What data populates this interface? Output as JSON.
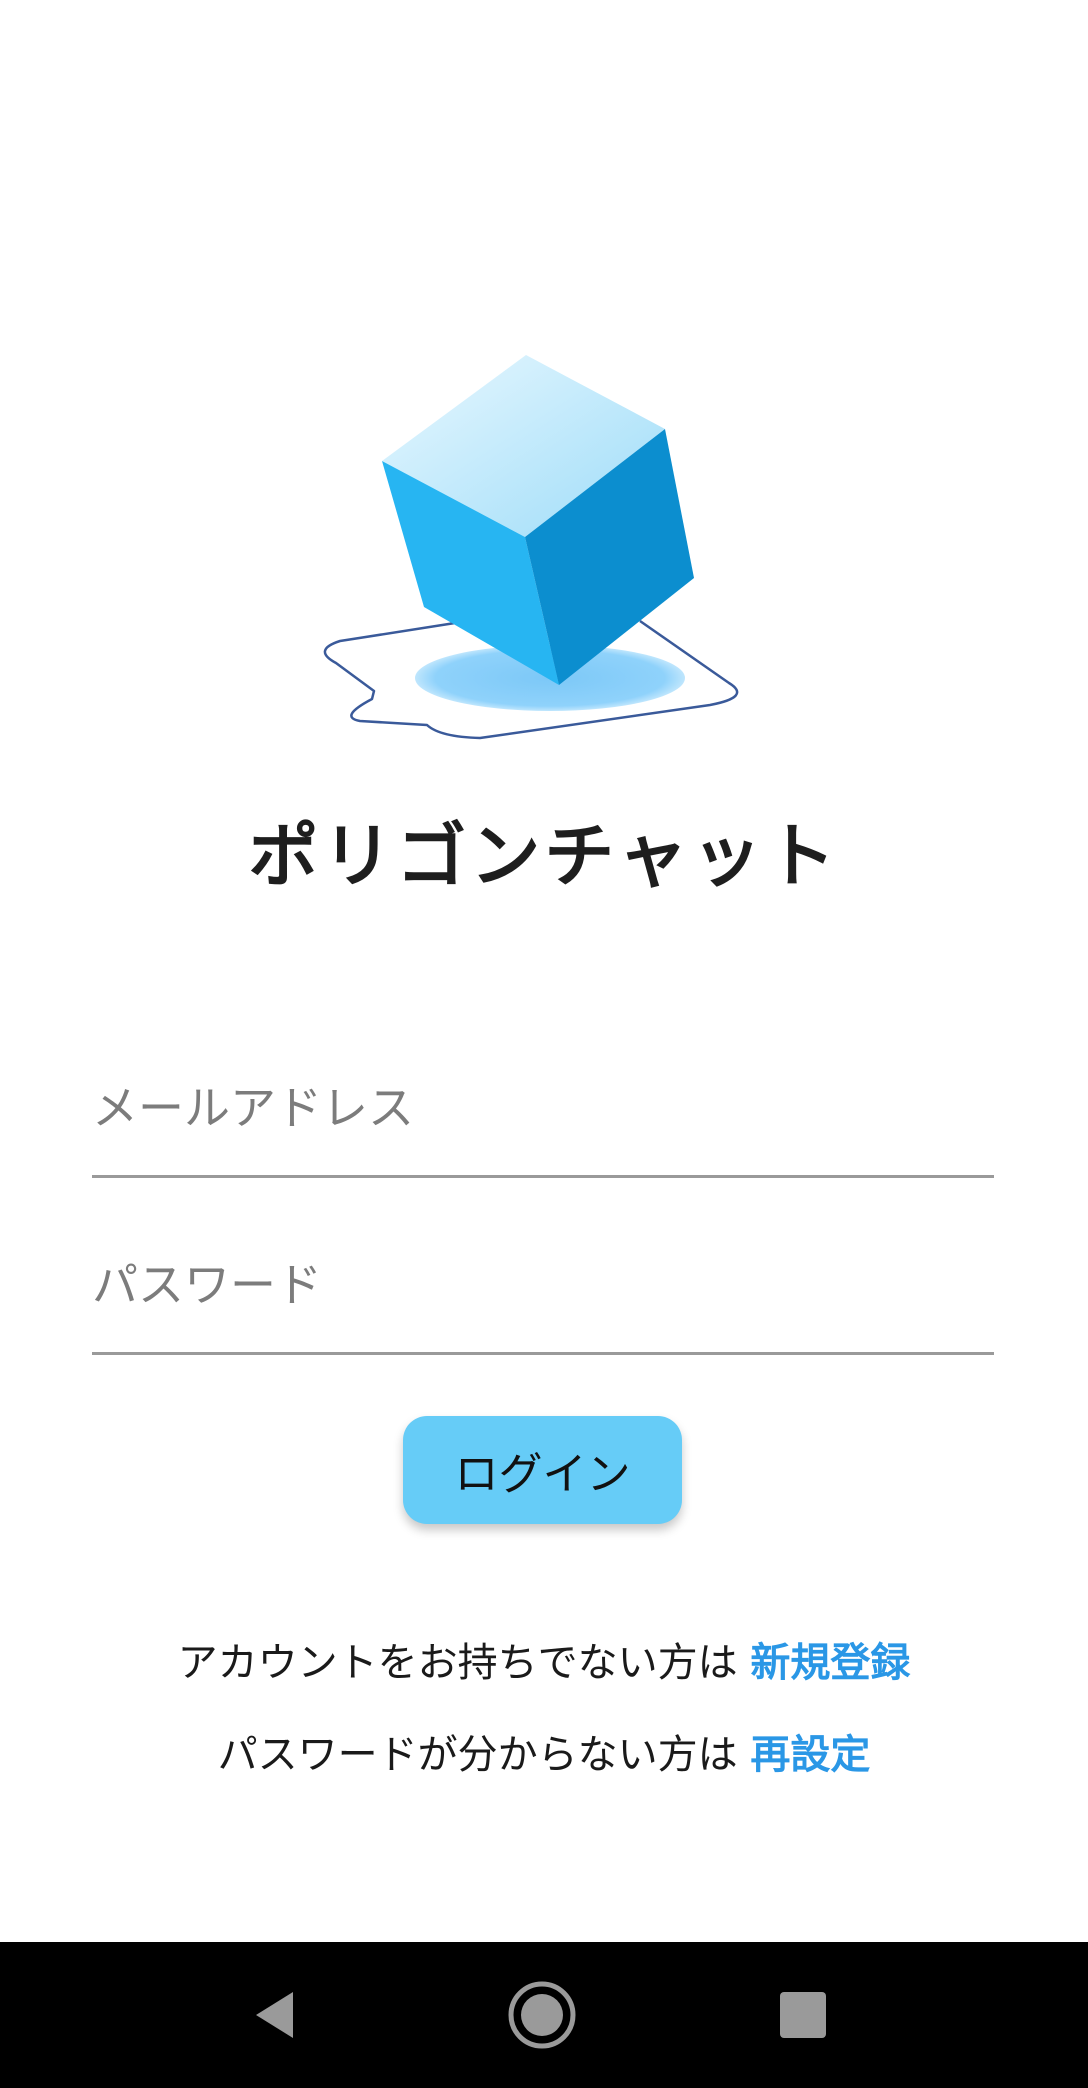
{
  "app": {
    "title": "ポリゴンチャット",
    "logo_icon": "cube-on-speech-bubble-icon"
  },
  "form": {
    "email_placeholder": "メールアドレス",
    "email_value": "",
    "password_placeholder": "パスワード",
    "password_value": "",
    "login_label": "ログイン"
  },
  "links": {
    "signup_prompt": "アカウントをお持ちでない方は",
    "signup_label": "新規登録",
    "reset_prompt": "パスワードが分からない方は",
    "reset_label": "再設定"
  },
  "navbar": {
    "back_icon": "back-triangle-icon",
    "home_icon": "home-circle-icon",
    "recents_icon": "recents-square-icon"
  },
  "colors": {
    "accent": "#66ccf7",
    "link": "#2a97e6",
    "cube_light": "#cdeffc",
    "cube_left": "#27b5f2",
    "cube_right": "#0c8ecf",
    "navbar": "#000000"
  }
}
